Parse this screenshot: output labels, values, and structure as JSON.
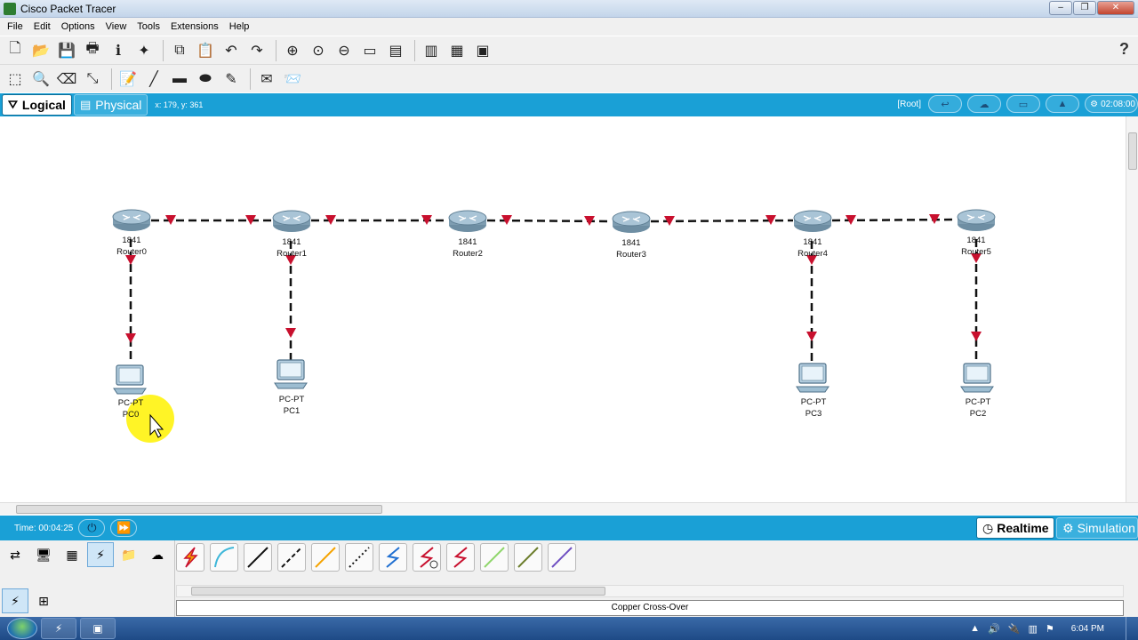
{
  "window": {
    "title": "Cisco Packet Tracer"
  },
  "menu": [
    "File",
    "Edit",
    "Options",
    "View",
    "Tools",
    "Extensions",
    "Help"
  ],
  "toolbar_main": {
    "icons": [
      "new-icon",
      "open-icon",
      "save-icon",
      "print-icon",
      "info-icon",
      "wizard-icon",
      "copy-icon",
      "paste-icon",
      "undo-icon",
      "redo-icon",
      "zoom-in-icon",
      "zoom-reset-icon",
      "zoom-out-icon",
      "drawing-palette-icon",
      "custom-device-icon",
      "pdu-list-icon",
      "viewport-icon",
      "screenshot-icon"
    ],
    "help": "?"
  },
  "toolbar_edit": {
    "icons": [
      "select-icon",
      "inspect-icon",
      "delete-icon",
      "resize-icon",
      "note-icon",
      "line-draw-icon",
      "rectangle-icon",
      "ellipse-icon",
      "freeform-icon",
      "simple-pdu-icon",
      "complex-pdu-icon"
    ]
  },
  "workspace": {
    "tab_logical": "Logical",
    "tab_physical": "Physical",
    "coords": "x: 179, y: 361",
    "root": "[Root]",
    "clock": "02:08:00"
  },
  "devices": {
    "routers": [
      {
        "model": "1841",
        "name": "Router0"
      },
      {
        "model": "1841",
        "name": "Router1"
      },
      {
        "model": "1841",
        "name": "Router2"
      },
      {
        "model": "1841",
        "name": "Router3"
      },
      {
        "model": "1841",
        "name": "Router4"
      },
      {
        "model": "1841",
        "name": "Router5"
      }
    ],
    "pcs": [
      {
        "model": "PC-PT",
        "name": "PC0"
      },
      {
        "model": "PC-PT",
        "name": "PC1"
      },
      {
        "model": "PC-PT",
        "name": "PC3"
      },
      {
        "model": "PC-PT",
        "name": "PC2"
      }
    ]
  },
  "timebar": {
    "time": "Time: 00:04:25",
    "realtime": "Realtime",
    "simulation": "Simulation"
  },
  "palette": {
    "selected_cable": "Copper Cross-Over",
    "colors": {
      "link": "#111111",
      "port_up": "#c8102e",
      "accent": "#1aa0d6"
    }
  },
  "taskbar": {
    "time": "6:04 PM"
  }
}
